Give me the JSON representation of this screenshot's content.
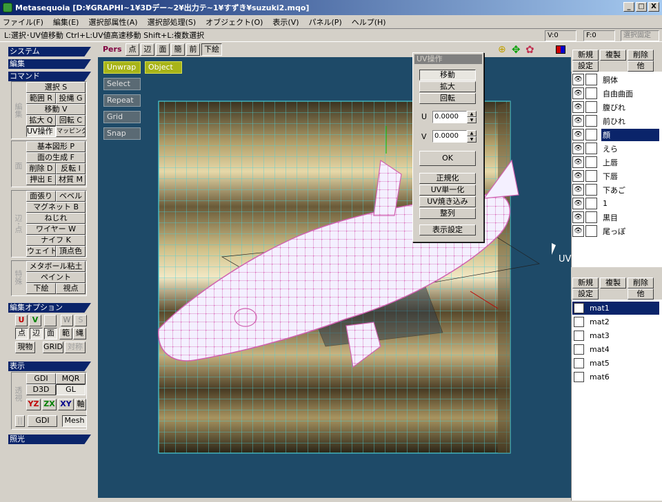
{
  "window": {
    "title": "Metasequoia [D:¥GRAPHI~1¥3Dデー~2¥出力テ~1¥すずき¥suzuki2.mqo]",
    "min": "_",
    "max": "□",
    "close": "X"
  },
  "menu": [
    "ファイル(F)",
    "編集(E)",
    "選択部属性(A)",
    "選択部処理(S)",
    "オブジェクト(O)",
    "表示(V)",
    "パネル(P)",
    "ヘルプ(H)"
  ],
  "status": {
    "hint": "L:選択･UV値移動  Ctrl+L:UV値高速移動  Shift+L:複数選択",
    "v": "V:0",
    "f": "F:0",
    "lock": "選択固定"
  },
  "left": {
    "system": "システム",
    "edit": "編集",
    "command": "コマンド",
    "group1_label": "編集",
    "group2_label": "面",
    "group3_label": "辺･点",
    "group4_label": "特殊",
    "cmd": [
      "選択 S",
      "範囲 R",
      "投縄 G",
      "移動 V",
      "拡大 Q",
      "回転 C",
      "UV操作 U",
      "マッピング"
    ],
    "face": [
      "基本図形 P",
      "面の生成 F",
      "削除 D",
      "反転 I",
      "押出 E",
      "材質 M"
    ],
    "edge": [
      "面張り",
      "ベベル",
      "マグネット B",
      "ねじれ",
      "ワイヤー W",
      "ナイフ K",
      "ウェイト",
      "頂点色"
    ],
    "special": [
      "メタボール粘土",
      "ペイント",
      "下絵",
      "視点"
    ],
    "editopt": "編集オプション",
    "opt": [
      "U",
      "V",
      "",
      "W",
      "S",
      "点",
      "辺",
      "面",
      "範",
      "縄",
      "現物",
      "GRID",
      "対称"
    ],
    "display": "表示",
    "display_label": "透視",
    "disp": [
      "GDI",
      "MQR",
      "D3D",
      "GL",
      "YZ",
      "ZX",
      "XY",
      "軸",
      "||",
      "GDI",
      "Mesh"
    ],
    "light": "照光"
  },
  "viewtools": [
    "Pers",
    "点",
    "辺",
    "面",
    "簡",
    "前",
    "下絵"
  ],
  "overlay": [
    "Unwrap",
    "Object",
    "Select",
    "Repeat",
    "Grid",
    "Snap"
  ],
  "uvdialog": {
    "title": "UV操作",
    "move": "移動",
    "scale": "拡大",
    "rotate": "回転",
    "u_label": "U",
    "u_value": "0.0000",
    "v_label": "V",
    "v_value": "0.0000",
    "ok": "OK",
    "normalize": "正規化",
    "uv_unify": "UV単一化",
    "bake": "UV焼き込み",
    "align": "整列",
    "display": "表示設定"
  },
  "objpanel": {
    "new": "新規",
    "copy": "複製",
    "del": "削除",
    "settings": "設定",
    "other": "他",
    "objects": [
      "胴体",
      "自由曲面",
      "腹びれ",
      "前ひれ",
      "顔",
      "えら",
      "上唇",
      "下唇",
      "下あご",
      "1",
      "黒目",
      "尾っぽ"
    ],
    "selected": 4
  },
  "matpanel": {
    "new": "新規",
    "copy": "複製",
    "del": "削除",
    "settings": "設定",
    "other": "他",
    "materials": [
      "mat1",
      "mat2",
      "mat3",
      "mat4",
      "mat5",
      "mat6"
    ],
    "selected": 0
  },
  "uv_cursor_label": "UV"
}
